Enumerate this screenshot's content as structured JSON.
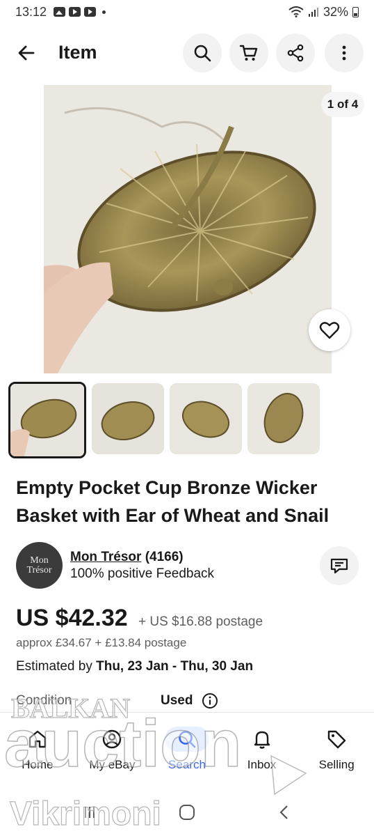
{
  "status_bar": {
    "time": "13:12",
    "battery": "32%"
  },
  "header": {
    "title": "Item"
  },
  "gallery": {
    "counter": "1 of 4"
  },
  "item": {
    "title": "Empty Pocket Cup Bronze Wicker Basket with Ear of Wheat and Snail"
  },
  "seller": {
    "avatar_line1": "Mon",
    "avatar_line2": "Trésor",
    "name": "Mon Trésor",
    "count": "(4166)",
    "feedback": "100% positive Feedback"
  },
  "price": {
    "main": "US $42.32",
    "postage": "+ US $16.88 postage",
    "approx": "approx £34.67 + £13.84 postage"
  },
  "delivery": {
    "prefix": "Estimated by ",
    "dates": "Thu, 23 Jan - Thu, 30 Jan"
  },
  "condition": {
    "label": "Condition",
    "value": "Used"
  },
  "bottom_nav": {
    "items": [
      {
        "label": "Home",
        "icon": "home-icon"
      },
      {
        "label": "My eBay",
        "icon": "account-icon"
      },
      {
        "label": "Search",
        "icon": "search-icon",
        "active": true
      },
      {
        "label": "Inbox",
        "icon": "bell-icon"
      },
      {
        "label": "Selling",
        "icon": "tag-icon"
      }
    ]
  },
  "watermark": {
    "line1": "BALKAN",
    "line2": "auction",
    "line3": "Vikrimoni"
  },
  "colors": {
    "accent": "#3665f3",
    "text": "#191919",
    "muted": "#5e5e5e"
  }
}
